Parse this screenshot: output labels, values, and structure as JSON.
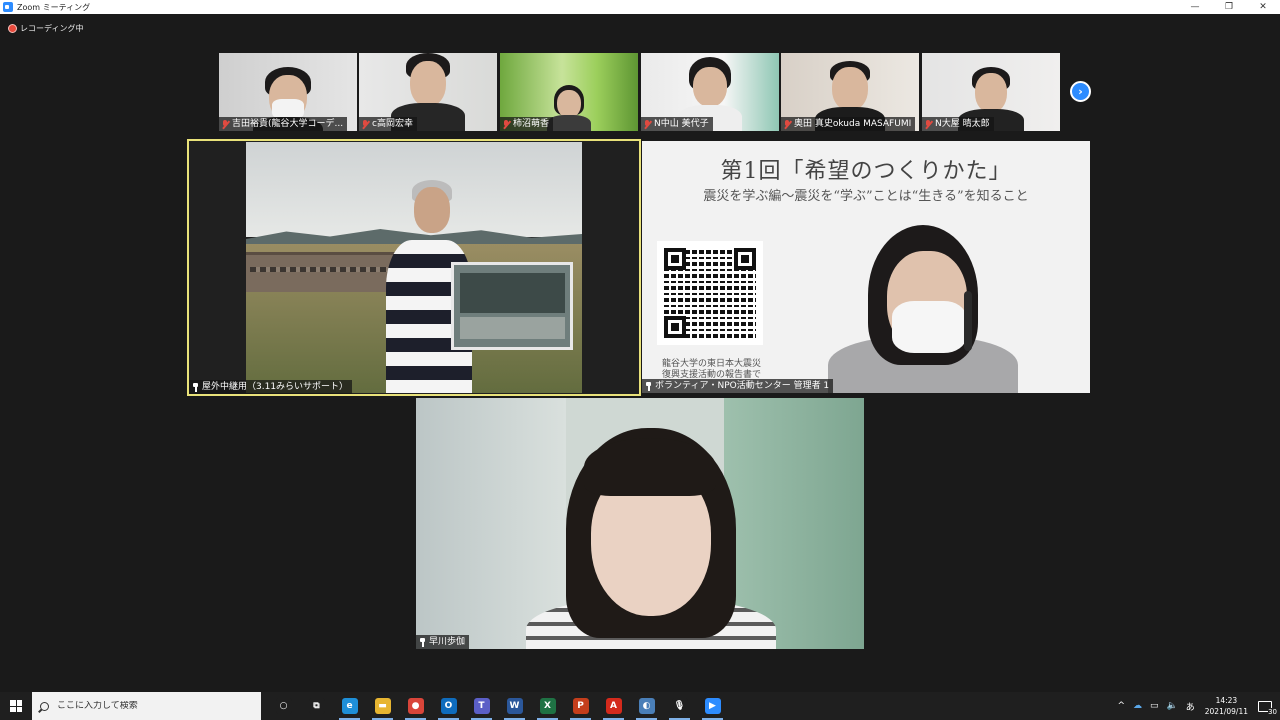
{
  "window": {
    "title": "Zoom ミーティング",
    "controls": [
      "—",
      "❐",
      "✕"
    ]
  },
  "recording": {
    "label": "レコーディング中"
  },
  "thumbnails": [
    {
      "name": "吉田裕貴(龍谷大学コーデ..."
    },
    {
      "name": "c高岡宏幸"
    },
    {
      "name": "柿沼萌香"
    },
    {
      "name": "N中山 美代子"
    },
    {
      "name": "奥田 真史okuda MASAFUMI"
    },
    {
      "name": "N大屋 晴太郎"
    }
  ],
  "gallery": {
    "next_label": "›"
  },
  "tiles": {
    "outdoor": {
      "name": "屋外中継用（3.11みらいサポート）"
    },
    "presentation": {
      "name": "ボランティア・NPO活動センター 管理者 1",
      "slide_title": "第1回「希望のつくりかた」",
      "slide_subtitle": "震災を学ぶ編～震災を“学ぶ”ことは“生きる”を知ること",
      "slide_caption_1": "龍谷大学の東日本大震災",
      "slide_caption_2": "復興支援活動の報告書で"
    },
    "hayakawa": {
      "name": "早川歩伽"
    }
  },
  "taskbar": {
    "search_placeholder": "ここに入力して検索",
    "apps": [
      {
        "icon": "cortana-icon",
        "glyph": "○",
        "color": "#1f1f1f"
      },
      {
        "icon": "task-view-icon",
        "glyph": "⧉",
        "color": "#1f1f1f"
      },
      {
        "icon": "edge-icon",
        "glyph": "e",
        "color": "#1e8fd8"
      },
      {
        "icon": "file-explorer-icon",
        "glyph": "▬",
        "color": "#e7b531"
      },
      {
        "icon": "chrome-icon",
        "glyph": "●",
        "color": "#d9453a"
      },
      {
        "icon": "outlook-icon",
        "glyph": "O",
        "color": "#0f6cbd"
      },
      {
        "icon": "teams-icon",
        "glyph": "T",
        "color": "#5b5fc7"
      },
      {
        "icon": "word-icon",
        "glyph": "W",
        "color": "#2b579a"
      },
      {
        "icon": "excel-icon",
        "glyph": "X",
        "color": "#1f7244"
      },
      {
        "icon": "powerpoint-icon",
        "glyph": "P",
        "color": "#c43e1c"
      },
      {
        "icon": "acrobat-icon",
        "glyph": "A",
        "color": "#d42a1c"
      },
      {
        "icon": "paint-icon",
        "glyph": "◐",
        "color": "#4a7fb8"
      },
      {
        "icon": "voice-recorder-icon",
        "glyph": "🎙",
        "color": "#1f1f1f"
      },
      {
        "icon": "zoom-icon",
        "glyph": "▶",
        "color": "#2d8cff"
      }
    ],
    "tray": {
      "chevron": "^",
      "ime": "あ",
      "time": "14:23",
      "date": "2021/09/11",
      "notification_count": "30"
    }
  },
  "colors": {
    "active_speaker_border": "#e9e27a",
    "zoom_blue": "#2d8cff",
    "muted_red": "#e04a40"
  }
}
